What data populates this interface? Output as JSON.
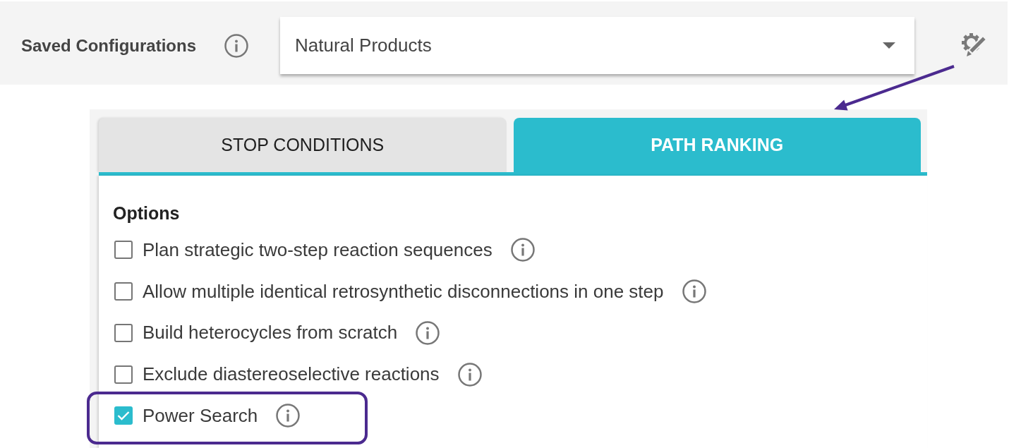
{
  "saved_configurations": {
    "label": "Saved Configurations",
    "select": {
      "value": "Natural Products"
    }
  },
  "tabs": [
    {
      "label": "STOP CONDITIONS",
      "selected": false
    },
    {
      "label": "PATH RANKING",
      "selected": true
    }
  ],
  "options": {
    "heading": "Options",
    "items": [
      {
        "label": "Plan strategic two-step reaction sequences",
        "checked": false,
        "highlighted": false
      },
      {
        "label": "Allow multiple identical retrosynthetic disconnections in one step",
        "checked": false,
        "highlighted": false
      },
      {
        "label": "Build heterocycles from scratch",
        "checked": false,
        "highlighted": false
      },
      {
        "label": "Exclude diastereoselective reactions",
        "checked": false,
        "highlighted": false
      },
      {
        "label": "Power Search",
        "checked": true,
        "highlighted": true
      }
    ]
  }
}
